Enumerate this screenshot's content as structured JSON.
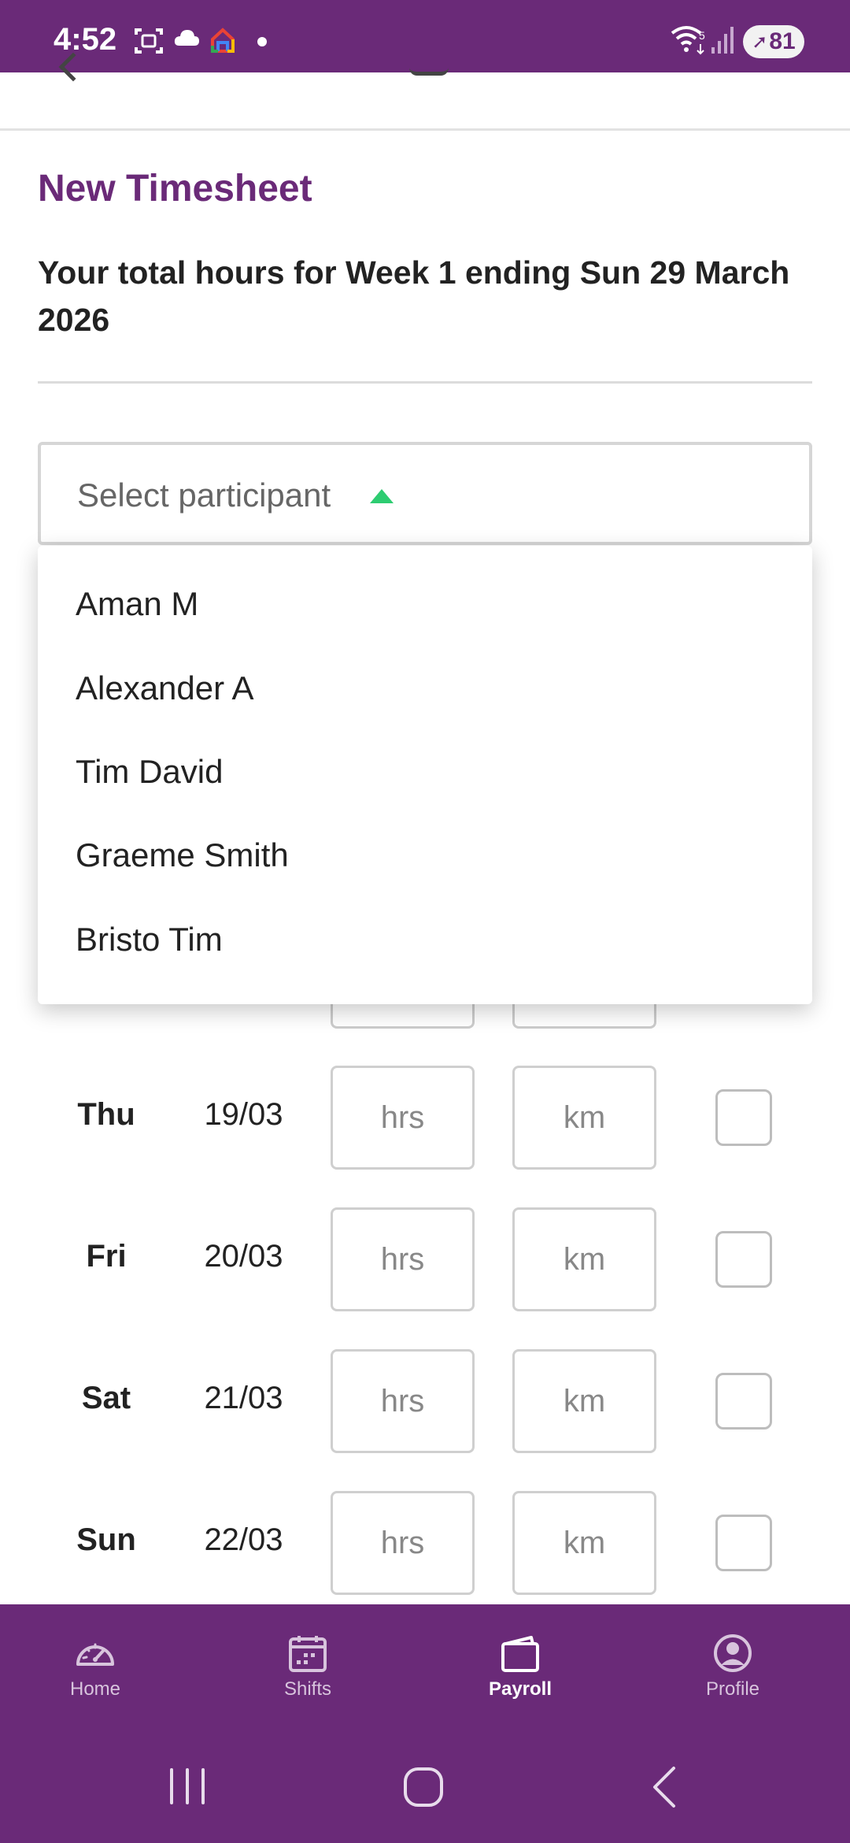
{
  "status_bar": {
    "time": "4:52",
    "battery": "81",
    "icons": [
      "screenshot-icon",
      "cloud-icon",
      "home-app-icon",
      "dot-icon",
      "wifi-icon",
      "signal-icon",
      "battery-icon"
    ]
  },
  "page": {
    "section_title": "New Timesheet",
    "total_hours_text": "Your total hours for Week 1 ending Sun 29 March 2026"
  },
  "participant_select": {
    "placeholder": "Select participant",
    "options": [
      "Aman M",
      "Alexander A",
      "Tim David",
      "Graeme Smith",
      "Bristo Tim"
    ]
  },
  "days": [
    {
      "day": "Thu",
      "date": "19/03",
      "hrs_placeholder": "hrs",
      "km_placeholder": "km"
    },
    {
      "day": "Fri",
      "date": "20/03",
      "hrs_placeholder": "hrs",
      "km_placeholder": "km"
    },
    {
      "day": "Sat",
      "date": "21/03",
      "hrs_placeholder": "hrs",
      "km_placeholder": "km"
    },
    {
      "day": "Sun",
      "date": "22/03",
      "hrs_placeholder": "hrs",
      "km_placeholder": "km"
    }
  ],
  "bottom_nav": {
    "items": [
      {
        "label": "Home",
        "icon": "speedometer-icon",
        "active": false
      },
      {
        "label": "Shifts",
        "icon": "calendar-icon",
        "active": false
      },
      {
        "label": "Payroll",
        "icon": "wallet-icon",
        "active": true
      },
      {
        "label": "Profile",
        "icon": "profile-icon",
        "active": false
      }
    ]
  },
  "colors": {
    "brand": "#6a2a78",
    "accent_caret": "#2ecc71"
  }
}
